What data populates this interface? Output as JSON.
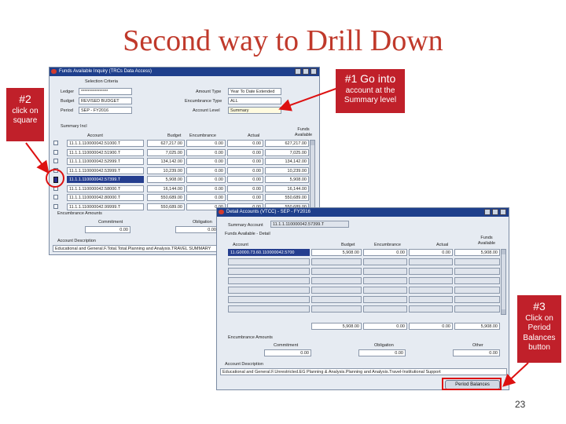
{
  "slide": {
    "title": "Second way to Drill Down",
    "page_number": "23"
  },
  "callouts": {
    "c1": {
      "title": "#1 Go into",
      "text": "account at the Summary level"
    },
    "c2": {
      "title": "#2",
      "text": "click on square"
    },
    "c3": {
      "title": "#3",
      "text": "Click on Period Balances button"
    }
  },
  "win1": {
    "title": "Funds Available Inquiry (TRCs Data Access)",
    "criteria_heading": "Selection Criteria",
    "ledger_label": "Ledger",
    "ledger_value": "****************",
    "budget_label": "Budget",
    "budget_value": "REVISED BUDGET",
    "period_label": "Period",
    "period_value": "SEP - FY2016",
    "amount_type_label": "Amount Type",
    "amount_type_value": "Year To Date Extended",
    "encumbrance_type_label": "Encumbrance Type",
    "encumbrance_type_value": "ALL",
    "account_level_label": "Account Level",
    "account_level_value": "Summary",
    "summary_label": "Summary Incl",
    "columns": [
      "Account",
      "Budget",
      "Encumbrance",
      "Actual",
      "Funds Available"
    ],
    "rows": [
      {
        "account": "11.1.1.110000042.51000.T",
        "budget": "627,217.00",
        "enc": "0.00",
        "actual": "0.00",
        "funds": "627,217.00"
      },
      {
        "account": "11.1.1.110000042.51900.T",
        "budget": "7,025.00",
        "enc": "0.00",
        "actual": "0.00",
        "funds": "7,025.00"
      },
      {
        "account": "11.1.1.110000042.52999.T",
        "budget": "134,142.00",
        "enc": "0.00",
        "actual": "0.00",
        "funds": "134,142.00"
      },
      {
        "account": "11.1.1.110000042.53999.T",
        "budget": "10,239.00",
        "enc": "0.00",
        "actual": "0.00",
        "funds": "10,239.00"
      },
      {
        "account": "11.1.1.110000042.57399.T",
        "budget": "5,908.00",
        "enc": "0.00",
        "actual": "0.00",
        "funds": "5,908.00"
      },
      {
        "account": "11.1.1.110000042.58000.T",
        "budget": "16,144.00",
        "enc": "0.00",
        "actual": "0.00",
        "funds": "16,144.00"
      },
      {
        "account": "11.1.1.110000042.80000.T",
        "budget": "550,689.00",
        "enc": "0.00",
        "actual": "0.00",
        "funds": "550,689.00"
      },
      {
        "account": "11.1.1.110000042.99999.T",
        "budget": "550,689.00",
        "enc": "0.00",
        "actual": "0.00",
        "funds": "550,689.00"
      }
    ],
    "encumbrance_heading": "Encumbrance Amounts",
    "commitment_label": "Commitment",
    "commitment_value": "0.00",
    "obligation_label": "Obligation",
    "obligation_value": "0.00",
    "account_desc_heading": "Account Description",
    "account_desc_value": "Educational and General.F.Total.Total.Planning and Analysis.TRAVEL SUMMARY"
  },
  "win2": {
    "title": "Detail Accounts (VTCC) - SEP - FY2016",
    "summary_account_label": "Summary Account",
    "summary_account_value": "11.1.1.110000042.57399.T",
    "funds_heading": "Funds Available - Detail",
    "columns": [
      "Account",
      "Budget",
      "Encumbrance",
      "Actual",
      "Funds Available"
    ],
    "first_row": {
      "account": "11.G0000.73.60.110000042.5700",
      "budget": "5,908.00",
      "enc": "0.00",
      "actual": "0.00",
      "funds": "5,908.00"
    },
    "totals": {
      "budget": "5,908.00",
      "enc": "0.00",
      "actual": "0.00",
      "funds": "5,908.00"
    },
    "encumbrance_heading": "Encumbrance Amounts",
    "commitment_label": "Commitment",
    "commitment_value": "0.00",
    "obligation_label": "Obligation",
    "obligation_value": "0.00",
    "other_label": "Other",
    "other_value": "0.00",
    "account_desc_heading": "Account Description",
    "account_desc_value": "Educational and General.F.Unrestricted.EG Planning & Analysis.Planning and Analysis.Travel-Institutional Support",
    "period_balances_button": "Period Balances"
  }
}
